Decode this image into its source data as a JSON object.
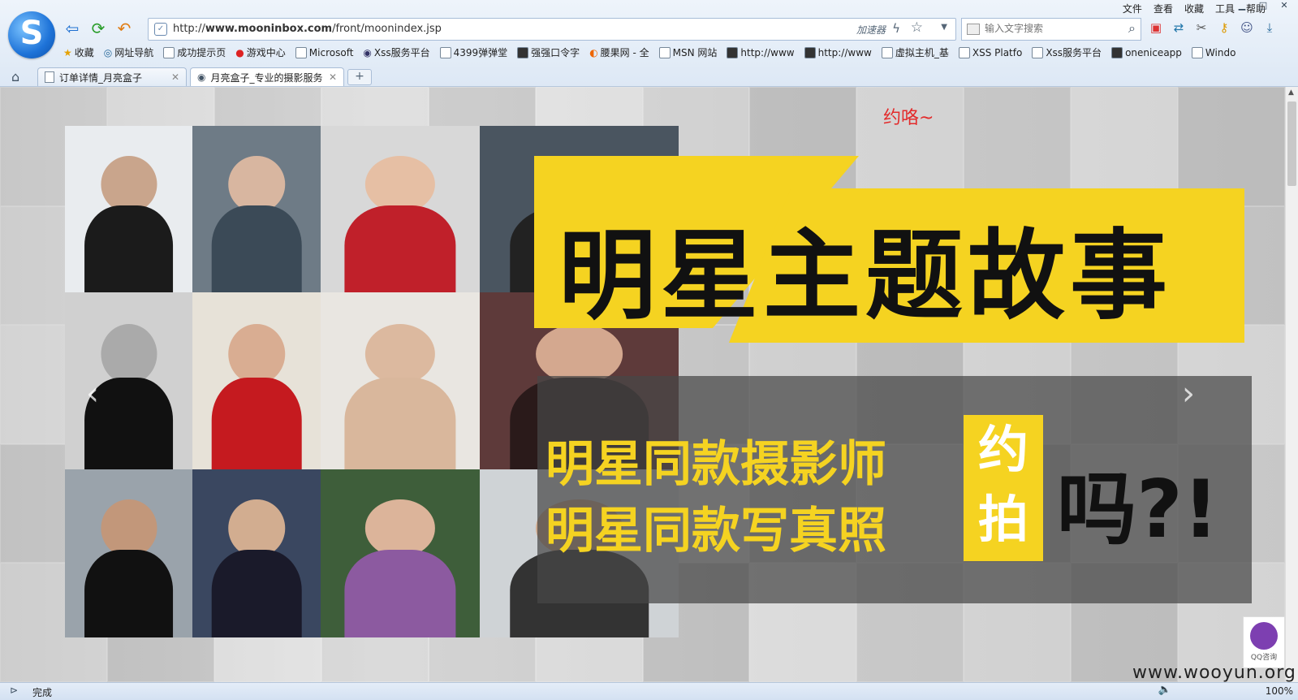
{
  "browser": {
    "menu": [
      "文件",
      "查看",
      "收藏",
      "工具",
      "帮助"
    ],
    "url_prefix": "http://",
    "url_domain": "www.mooninbox.com",
    "url_path": "/front/moonindex.jsp",
    "accelerator": "加速器",
    "search_placeholder": "输入文字搜索",
    "bookmarks": [
      "收藏",
      "网址导航",
      "成功提示页",
      "游戏中心",
      "Microsoft",
      "Xss服务平台",
      "4399弹弹堂",
      "强强口令字",
      "腰果网 - 全",
      "MSN 网站",
      "http://www",
      "http://www",
      "虚拟主机_基",
      "XSS Platfo",
      "Xss服务平台",
      "oneniceapp",
      "Windo"
    ],
    "tabs": [
      {
        "label": "订单详情_月亮盒子"
      },
      {
        "label": "月亮盒子_专业的摄影服务"
      }
    ],
    "new_tab": "+",
    "status": "完成",
    "zoom": "100%"
  },
  "page": {
    "note": "约咯~",
    "banner_title": "明星主题故事",
    "line1": "明星同款摄影师",
    "line2": "明星同款写真照",
    "yue": "约",
    "pai": "拍",
    "ma": "吗?!",
    "qq_label": "QQ咨询",
    "watermark": "www.wooyun.org"
  }
}
